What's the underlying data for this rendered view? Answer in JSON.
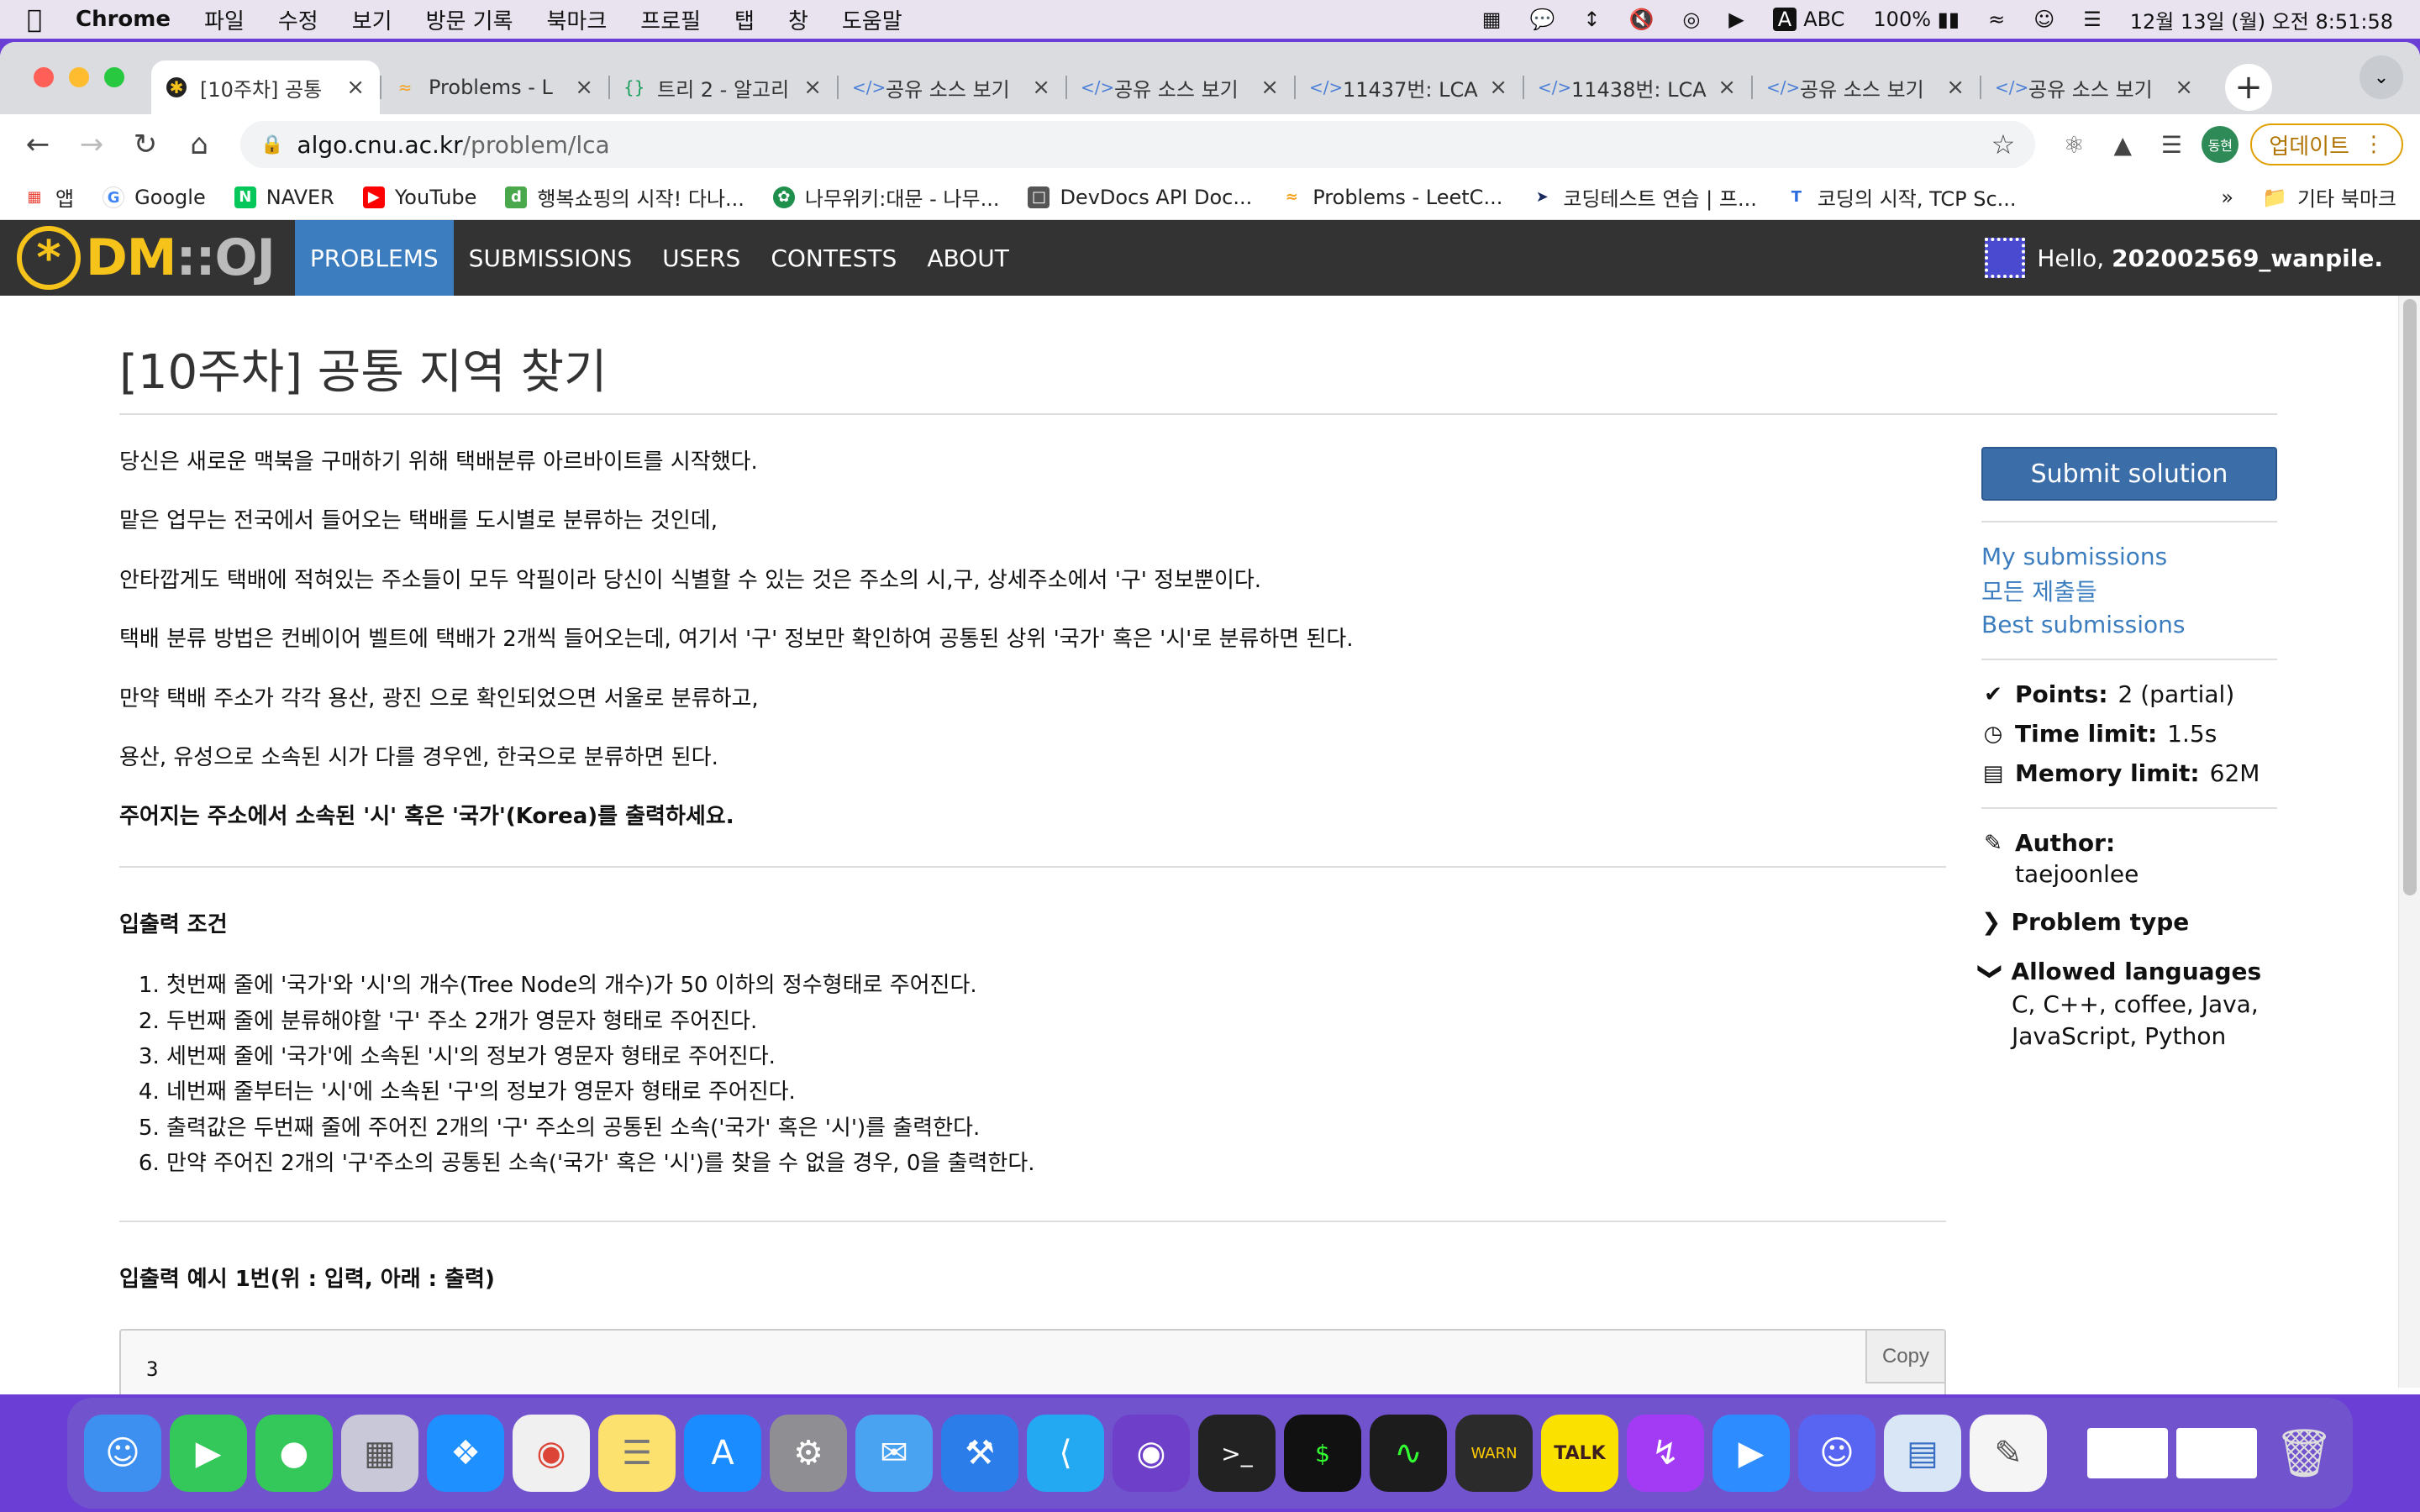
{
  "menubar": {
    "app": "Chrome",
    "items": [
      "파일",
      "수정",
      "보기",
      "방문 기록",
      "북마크",
      "프로필",
      "탭",
      "창",
      "도움말"
    ],
    "input_source": "ABC",
    "battery": "100%",
    "datetime": "12월 13일 (월) 오전 8:51:58"
  },
  "tabs": [
    {
      "label": "[10주차] 공통",
      "icon": "star-icon",
      "active": true
    },
    {
      "label": "Problems - L",
      "icon": "leetcode-icon"
    },
    {
      "label": "트리 2 - 알고리",
      "icon": "braces-icon"
    },
    {
      "label": "공유 소스 보기",
      "icon": "code-icon"
    },
    {
      "label": "공유 소스 보기",
      "icon": "code-icon"
    },
    {
      "label": "11437번: LCA",
      "icon": "code-icon"
    },
    {
      "label": "11438번: LCA",
      "icon": "code-icon"
    },
    {
      "label": "공유 소스 보기",
      "icon": "code-icon"
    },
    {
      "label": "공유 소스 보기",
      "icon": "code-icon"
    }
  ],
  "toolbar": {
    "url_host": "algo.cnu.ac.kr",
    "url_path": "/problem/lca",
    "profile_label": "동현",
    "update_label": "업데이트"
  },
  "bookmarks": [
    {
      "label": "앱",
      "color": "#e94235"
    },
    {
      "label": "Google",
      "color": "#4285f4"
    },
    {
      "label": "NAVER",
      "color": "#03c75a"
    },
    {
      "label": "YouTube",
      "color": "#ff0000"
    },
    {
      "label": "행복쇼핑의 시작! 다나...",
      "color": "#49a84b"
    },
    {
      "label": "나무위키:대문 - 나무...",
      "color": "#1f8f4c"
    },
    {
      "label": "DevDocs API Doc...",
      "color": "#555555"
    },
    {
      "label": "Problems - LeetC...",
      "color": "#f89f1b"
    },
    {
      "label": "코딩테스트 연습 | 프...",
      "color": "#1b2a5e"
    },
    {
      "label": "코딩의 시작, TCP Sc...",
      "color": "#2d6cdf"
    }
  ],
  "bookmarks_more": "»",
  "bookmarks_other": "기타 북마크",
  "site": {
    "logo_text": "DM",
    "logo_sep": "::",
    "logo_text2": "OJ",
    "nav": [
      "PROBLEMS",
      "SUBMISSIONS",
      "USERS",
      "CONTESTS",
      "ABOUT"
    ],
    "hello_prefix": "Hello, ",
    "username": "202002569_wanpile."
  },
  "problem": {
    "title": "[10주차] 공통 지역 찾기",
    "paragraphs": [
      "당신은 새로운 맥북을 구매하기 위해 택배분류 아르바이트를 시작했다.",
      "맡은 업무는 전국에서 들어오는 택배를 도시별로 분류하는 것인데,",
      "안타깝게도 택배에 적혀있는 주소들이 모두 악필이라 당신이 식별할 수 있는 것은 주소의 시,구, 상세주소에서 '구' 정보뿐이다.",
      "택배 분류 방법은 컨베이어 벨트에 택배가 2개씩 들어오는데, 여기서 '구' 정보만 확인하여 공통된 상위 '국가' 혹은 '시'로 분류하면 된다.",
      "만약 택배 주소가 각각 용산, 광진 으로 확인되었으면 서울로 분류하고,",
      "용산, 유성으로 소속된 시가 다를 경우엔, 한국으로 분류하면 된다."
    ],
    "bold_line": "주어지는 주소에서 소속된 '시' 혹은 '국가'(Korea)를 출력하세요.",
    "io_heading": "입출력 조건",
    "io_items": [
      "첫번째 줄에 '국가'와 '시'의 개수(Tree Node의 개수)가 50 이하의 정수형태로 주어진다.",
      "두번째 줄에 분류해야할 '구' 주소 2개가 영문자 형태로 주어진다.",
      "세번째 줄에 '국가'에 소속된 '시'의 정보가 영문자 형태로 주어진다.",
      "네번째 줄부터는 '시'에 소속된 '구'의 정보가 영문자 형태로 주어진다.",
      "출력값은 두번째 줄에 주어진 2개의 '구' 주소의 공통된 소속('국가' 혹은 '시')를 출력한다.",
      "만약 주어진 2개의 '구'주소의 공통된 소속('국가' 혹은 '시')를 찾을 수 없을 경우, 0을 출력한다."
    ],
    "example_heading": "입출력 예시 1번(위 : 입력, 아래 : 출력)",
    "example_first_line": "3",
    "copy_label": "Copy"
  },
  "sidebar": {
    "submit_label": "Submit solution",
    "links": [
      "My submissions",
      "모든 제출들",
      "Best submissions"
    ],
    "points_label": "Points:",
    "points_value": "2 (partial)",
    "time_label": "Time limit:",
    "time_value": "1.5s",
    "memory_label": "Memory limit:",
    "memory_value": "62M",
    "author_label": "Author:",
    "author_value": "taejoonlee",
    "problem_type_label": "Problem type",
    "allowed_languages_label": "Allowed languages",
    "allowed_languages_value": "C, C++, coffee, Java, JavaScript, Python"
  },
  "dock": [
    {
      "name": "finder-icon",
      "color": "#3d8ff0"
    },
    {
      "name": "facetime-icon",
      "color": "#34c759"
    },
    {
      "name": "messages-icon",
      "color": "#34c759"
    },
    {
      "name": "launchpad-icon",
      "color": "#c8c8d8"
    },
    {
      "name": "safari-icon",
      "color": "#1e90ff"
    },
    {
      "name": "chrome-icon",
      "color": "#f0f0f0"
    },
    {
      "name": "notes-icon",
      "color": "#fce16e"
    },
    {
      "name": "app-store-icon",
      "color": "#1a8cff"
    },
    {
      "name": "system-preferences-icon",
      "color": "#8e8e93"
    },
    {
      "name": "mail-icon",
      "color": "#4aa3f0"
    },
    {
      "name": "xcode-icon",
      "color": "#2b7de9"
    },
    {
      "name": "vscode-icon",
      "color": "#23a9f2"
    },
    {
      "name": "github-desktop-icon",
      "color": "#6e40c9"
    },
    {
      "name": "terminal-icon",
      "color": "#222222"
    },
    {
      "name": "iterm-icon",
      "color": "#111111"
    },
    {
      "name": "activity-monitor-icon",
      "color": "#1c1c1c"
    },
    {
      "name": "console-icon",
      "color": "#2b2b2b"
    },
    {
      "name": "kakaotalk-icon",
      "color": "#fae100"
    },
    {
      "name": "messenger-icon",
      "color": "#a33bf5"
    },
    {
      "name": "zoom-icon",
      "color": "#2d8cff"
    },
    {
      "name": "discord-icon",
      "color": "#5865f2"
    },
    {
      "name": "preview-icon",
      "color": "#d9e6f5"
    },
    {
      "name": "textedit-icon",
      "color": "#f5f5f5"
    }
  ]
}
